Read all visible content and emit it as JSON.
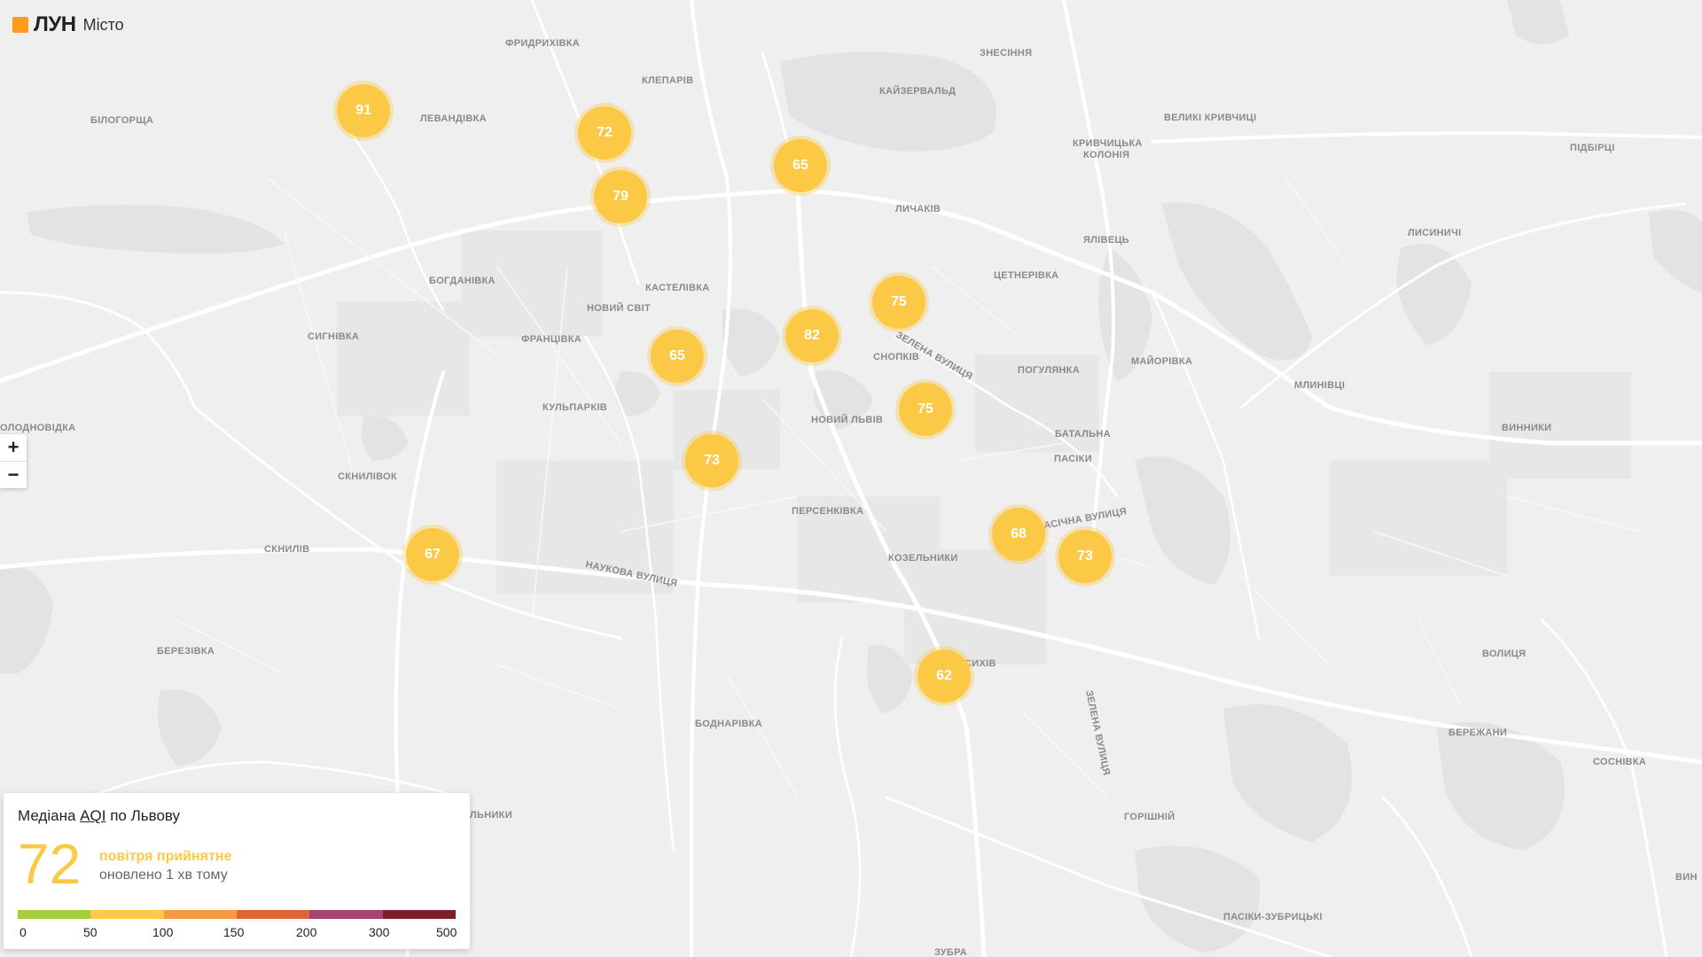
{
  "logo": {
    "brand": "ЛУН",
    "sub": "Місто",
    "color": "#ff9a1f"
  },
  "zoom": {
    "in_label": "+",
    "out_label": "−"
  },
  "districts": [
    {
      "name": "ФРИДРИХІВКА"
    },
    {
      "name": "ЗНЕСІННЯ"
    },
    {
      "name": "КЛЕПАРІВ"
    },
    {
      "name": "КАЙЗЕРВАЛЬД"
    },
    {
      "name": "БІЛОГОРЩА"
    },
    {
      "name": "ЛЕВАНДІВКА"
    },
    {
      "name": "ВЕЛИКІ КРИВЧИЦІ"
    },
    {
      "name": "ПІДБІРЦІ"
    },
    {
      "name": "КРИВЧИЦЬКА"
    },
    {
      "name": "КОЛОНІЯ"
    },
    {
      "name": "ЛИЧАКІВ"
    },
    {
      "name": "ЯЛІВЕЦЬ"
    },
    {
      "name": "ЛИСИНИЧІ"
    },
    {
      "name": "ЦЕТНЕРІВКА"
    },
    {
      "name": "БОГДАНІВКА"
    },
    {
      "name": "КАСТЕЛІВКА"
    },
    {
      "name": "НОВИЙ СВІТ"
    },
    {
      "name": "СИГНІВКА"
    },
    {
      "name": "ФРАНЦІВКА"
    },
    {
      "name": "СНОПКІВ"
    },
    {
      "name": "ПОГУЛЯНКА"
    },
    {
      "name": "МАЙОРІВКА"
    },
    {
      "name": "МЛИНІВЦІ"
    },
    {
      "name": "КУЛЬПАРКІВ"
    },
    {
      "name": "НОВИЙ ЛЬВІВ"
    },
    {
      "name": "БАТАЛЬНА"
    },
    {
      "name": "ВИННИКИ"
    },
    {
      "name": "ОЛОДНОВІДКА"
    },
    {
      "name": "ПАСІКИ"
    },
    {
      "name": "СКНИЛІВОК"
    },
    {
      "name": "ПЕРСЕНКІВКА"
    },
    {
      "name": "СКНИЛІВ"
    },
    {
      "name": "КОЗЕЛЬНИКИ"
    },
    {
      "name": "НАУКОВА ВУЛИЦЯ"
    },
    {
      "name": "БЕРЕЗІВКА"
    },
    {
      "name": "СИХІВ"
    },
    {
      "name": "ВОЛИЦЯ"
    },
    {
      "name": "БОДНАРІВКА"
    },
    {
      "name": "БЕРЕЖАНИ"
    },
    {
      "name": "СОСНІВКА"
    },
    {
      "name": "ГОРІШНІЙ"
    },
    {
      "name": "ЛЬНИКИ"
    },
    {
      "name": "ВИН"
    },
    {
      "name": "ПАСІКИ-ЗУБРИЦЬКІ"
    },
    {
      "name": "ЗУБРА"
    },
    {
      "name": "ЗЕЛЕНА ВУЛИЦЯ"
    },
    {
      "name": "ЗЕЛЕНА ВУЛИЦЯ"
    },
    {
      "name": "ПАСІЧНА ВУЛИЦЯ"
    }
  ],
  "clusters": [
    {
      "value": "91"
    },
    {
      "value": "72"
    },
    {
      "value": "79"
    },
    {
      "value": "65"
    },
    {
      "value": "75"
    },
    {
      "value": "82"
    },
    {
      "value": "65"
    },
    {
      "value": "75"
    },
    {
      "value": "73"
    },
    {
      "value": "67"
    },
    {
      "value": "68"
    },
    {
      "value": "73"
    },
    {
      "value": "62"
    }
  ],
  "cluster_color": "#fbc945",
  "summary": {
    "title_prefix": "Медіана",
    "title_link": "AQI",
    "title_suffix": "по Львову",
    "value": "72",
    "status": "повітря прийнятне",
    "updated": "оновлено 1 хв тому"
  },
  "aqi_scale": {
    "labels": [
      "0",
      "50",
      "100",
      "150",
      "200",
      "300",
      "500"
    ],
    "colors": [
      "#a3cd3b",
      "#fbc945",
      "#f59a42",
      "#e0633a",
      "#a0476e",
      "#7d1f2b"
    ]
  }
}
